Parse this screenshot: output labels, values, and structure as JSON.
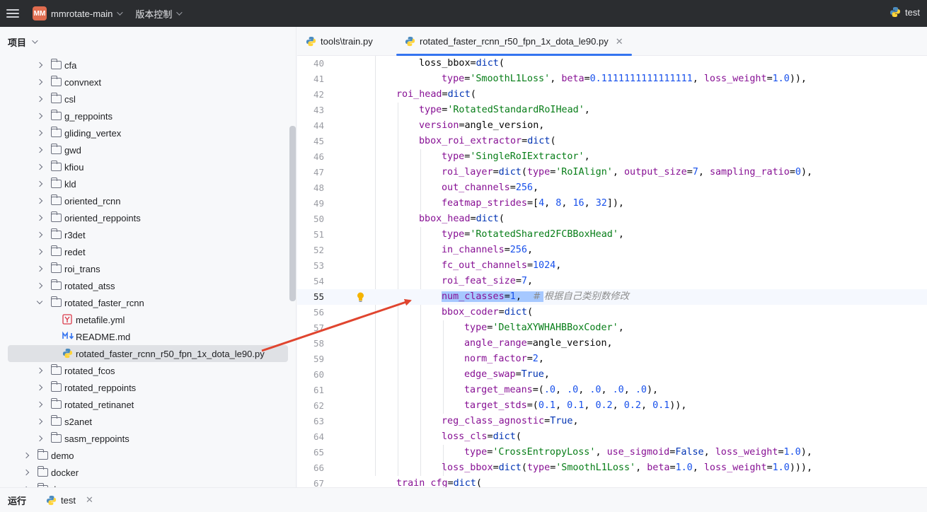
{
  "titlebar": {
    "project_badge": "MM",
    "project_name": "mmrotate-main",
    "vcs_label": "版本控制",
    "run_config": "test"
  },
  "project_panel": {
    "title": "项目",
    "tree": [
      {
        "label": "cfa",
        "type": "folder",
        "depth": 2,
        "expanded": false
      },
      {
        "label": "convnext",
        "type": "folder",
        "depth": 2,
        "expanded": false
      },
      {
        "label": "csl",
        "type": "folder",
        "depth": 2,
        "expanded": false
      },
      {
        "label": "g_reppoints",
        "type": "folder",
        "depth": 2,
        "expanded": false
      },
      {
        "label": "gliding_vertex",
        "type": "folder",
        "depth": 2,
        "expanded": false
      },
      {
        "label": "gwd",
        "type": "folder",
        "depth": 2,
        "expanded": false
      },
      {
        "label": "kfiou",
        "type": "folder",
        "depth": 2,
        "expanded": false
      },
      {
        "label": "kld",
        "type": "folder",
        "depth": 2,
        "expanded": false
      },
      {
        "label": "oriented_rcnn",
        "type": "folder",
        "depth": 2,
        "expanded": false
      },
      {
        "label": "oriented_reppoints",
        "type": "folder",
        "depth": 2,
        "expanded": false
      },
      {
        "label": "r3det",
        "type": "folder",
        "depth": 2,
        "expanded": false
      },
      {
        "label": "redet",
        "type": "folder",
        "depth": 2,
        "expanded": false
      },
      {
        "label": "roi_trans",
        "type": "folder",
        "depth": 2,
        "expanded": false
      },
      {
        "label": "rotated_atss",
        "type": "folder",
        "depth": 2,
        "expanded": false
      },
      {
        "label": "rotated_faster_rcnn",
        "type": "folder",
        "depth": 2,
        "expanded": true
      },
      {
        "label": "metafile.yml",
        "type": "yaml",
        "depth": 3
      },
      {
        "label": "README.md",
        "type": "md",
        "depth": 3
      },
      {
        "label": "rotated_faster_rcnn_r50_fpn_1x_dota_le90.py",
        "type": "py",
        "depth": 3,
        "selected": true
      },
      {
        "label": "rotated_fcos",
        "type": "folder",
        "depth": 2,
        "expanded": false
      },
      {
        "label": "rotated_reppoints",
        "type": "folder",
        "depth": 2,
        "expanded": false
      },
      {
        "label": "rotated_retinanet",
        "type": "folder",
        "depth": 2,
        "expanded": false
      },
      {
        "label": "s2anet",
        "type": "folder",
        "depth": 2,
        "expanded": false
      },
      {
        "label": "sasm_reppoints",
        "type": "folder",
        "depth": 2,
        "expanded": false
      },
      {
        "label": "demo",
        "type": "folder",
        "depth": 1,
        "expanded": false
      },
      {
        "label": "docker",
        "type": "folder",
        "depth": 1,
        "expanded": false
      },
      {
        "label": "d",
        "type": "folder",
        "depth": 1,
        "expanded": false
      }
    ]
  },
  "tabs": [
    {
      "label": "tools\\train.py",
      "active": false
    },
    {
      "label": "rotated_faster_rcnn_r50_fpn_1x_dota_le90.py",
      "active": true
    }
  ],
  "editor": {
    "current_line": 55,
    "lines": [
      {
        "n": 40,
        "indent": 2,
        "tokens": [
          [
            "p",
            "loss_bbox="
          ],
          [
            "bi",
            "dict"
          ],
          [
            "p",
            "("
          ]
        ]
      },
      {
        "n": 41,
        "indent": 3,
        "tokens": [
          [
            "kw",
            "type"
          ],
          [
            "p",
            "="
          ],
          [
            "str",
            "'SmoothL1Loss'"
          ],
          [
            "p",
            ", "
          ],
          [
            "kw",
            "beta"
          ],
          [
            "p",
            "="
          ],
          [
            "num",
            "0.1111111111111111"
          ],
          [
            "p",
            ", "
          ],
          [
            "kw",
            "loss_weight"
          ],
          [
            "p",
            "="
          ],
          [
            "num",
            "1.0"
          ],
          [
            "p",
            ")),"
          ]
        ]
      },
      {
        "n": 42,
        "indent": 1,
        "tokens": [
          [
            "kw",
            "roi_head"
          ],
          [
            "p",
            "="
          ],
          [
            "bi",
            "dict"
          ],
          [
            "p",
            "("
          ]
        ]
      },
      {
        "n": 43,
        "indent": 2,
        "tokens": [
          [
            "kw",
            "type"
          ],
          [
            "p",
            "="
          ],
          [
            "str",
            "'RotatedStandardRoIHead'"
          ],
          [
            "p",
            ","
          ]
        ]
      },
      {
        "n": 44,
        "indent": 2,
        "tokens": [
          [
            "kw",
            "version"
          ],
          [
            "p",
            "=angle_version,"
          ]
        ]
      },
      {
        "n": 45,
        "indent": 2,
        "tokens": [
          [
            "kw",
            "bbox_roi_extractor"
          ],
          [
            "p",
            "="
          ],
          [
            "bi",
            "dict"
          ],
          [
            "p",
            "("
          ]
        ]
      },
      {
        "n": 46,
        "indent": 3,
        "tokens": [
          [
            "kw",
            "type"
          ],
          [
            "p",
            "="
          ],
          [
            "str",
            "'SingleRoIExtractor'"
          ],
          [
            "p",
            ","
          ]
        ]
      },
      {
        "n": 47,
        "indent": 3,
        "tokens": [
          [
            "kw",
            "roi_layer"
          ],
          [
            "p",
            "="
          ],
          [
            "bi",
            "dict"
          ],
          [
            "p",
            "("
          ],
          [
            "kw",
            "type"
          ],
          [
            "p",
            "="
          ],
          [
            "str",
            "'RoIAlign'"
          ],
          [
            "p",
            ", "
          ],
          [
            "kw",
            "output_size"
          ],
          [
            "p",
            "="
          ],
          [
            "num",
            "7"
          ],
          [
            "p",
            ", "
          ],
          [
            "kw",
            "sampling_ratio"
          ],
          [
            "p",
            "="
          ],
          [
            "num",
            "0"
          ],
          [
            "p",
            "),"
          ]
        ]
      },
      {
        "n": 48,
        "indent": 3,
        "tokens": [
          [
            "kw",
            "out_channels"
          ],
          [
            "p",
            "="
          ],
          [
            "num",
            "256"
          ],
          [
            "p",
            ","
          ]
        ]
      },
      {
        "n": 49,
        "indent": 3,
        "tokens": [
          [
            "kw",
            "featmap_strides"
          ],
          [
            "p",
            "=["
          ],
          [
            "num",
            "4"
          ],
          [
            "p",
            ", "
          ],
          [
            "num",
            "8"
          ],
          [
            "p",
            ", "
          ],
          [
            "num",
            "16"
          ],
          [
            "p",
            ", "
          ],
          [
            "num",
            "32"
          ],
          [
            "p",
            "]),"
          ]
        ]
      },
      {
        "n": 50,
        "indent": 2,
        "tokens": [
          [
            "kw",
            "bbox_head"
          ],
          [
            "p",
            "="
          ],
          [
            "bi",
            "dict"
          ],
          [
            "p",
            "("
          ]
        ]
      },
      {
        "n": 51,
        "indent": 3,
        "tokens": [
          [
            "kw",
            "type"
          ],
          [
            "p",
            "="
          ],
          [
            "str",
            "'RotatedShared2FCBBoxHead'"
          ],
          [
            "p",
            ","
          ]
        ]
      },
      {
        "n": 52,
        "indent": 3,
        "tokens": [
          [
            "kw",
            "in_channels"
          ],
          [
            "p",
            "="
          ],
          [
            "num",
            "256"
          ],
          [
            "p",
            ","
          ]
        ]
      },
      {
        "n": 53,
        "indent": 3,
        "tokens": [
          [
            "kw",
            "fc_out_channels"
          ],
          [
            "p",
            "="
          ],
          [
            "num",
            "1024"
          ],
          [
            "p",
            ","
          ]
        ]
      },
      {
        "n": 54,
        "indent": 3,
        "tokens": [
          [
            "kw",
            "roi_feat_size"
          ],
          [
            "p",
            "="
          ],
          [
            "num",
            "7"
          ],
          [
            "p",
            ","
          ]
        ]
      },
      {
        "n": 55,
        "indent": 3,
        "tokens": [
          [
            "kwh",
            "num_classes"
          ],
          [
            "ph",
            "="
          ],
          [
            "numh",
            "1"
          ],
          [
            "ph",
            ",  "
          ],
          [
            "cmth",
            "# "
          ],
          [
            "cmt",
            "根据自己类别数修改"
          ]
        ]
      },
      {
        "n": 56,
        "indent": 3,
        "tokens": [
          [
            "kw",
            "bbox_coder"
          ],
          [
            "p",
            "="
          ],
          [
            "bi",
            "dict"
          ],
          [
            "p",
            "("
          ]
        ]
      },
      {
        "n": 57,
        "indent": 4,
        "tokens": [
          [
            "kw",
            "type"
          ],
          [
            "p",
            "="
          ],
          [
            "str",
            "'DeltaXYWHAHBBoxCoder'"
          ],
          [
            "p",
            ","
          ]
        ]
      },
      {
        "n": 58,
        "indent": 4,
        "tokens": [
          [
            "kw",
            "angle_range"
          ],
          [
            "p",
            "=angle_version,"
          ]
        ]
      },
      {
        "n": 59,
        "indent": 4,
        "tokens": [
          [
            "kw",
            "norm_factor"
          ],
          [
            "p",
            "="
          ],
          [
            "num",
            "2"
          ],
          [
            "p",
            ","
          ]
        ]
      },
      {
        "n": 60,
        "indent": 4,
        "tokens": [
          [
            "kw",
            "edge_swap"
          ],
          [
            "p",
            "="
          ],
          [
            "bi",
            "True"
          ],
          [
            "p",
            ","
          ]
        ]
      },
      {
        "n": 61,
        "indent": 4,
        "tokens": [
          [
            "kw",
            "target_means"
          ],
          [
            "p",
            "=("
          ],
          [
            "num",
            ".0"
          ],
          [
            "p",
            ", "
          ],
          [
            "num",
            ".0"
          ],
          [
            "p",
            ", "
          ],
          [
            "num",
            ".0"
          ],
          [
            "p",
            ", "
          ],
          [
            "num",
            ".0"
          ],
          [
            "p",
            ", "
          ],
          [
            "num",
            ".0"
          ],
          [
            "p",
            "),"
          ]
        ]
      },
      {
        "n": 62,
        "indent": 4,
        "tokens": [
          [
            "kw",
            "target_stds"
          ],
          [
            "p",
            "=("
          ],
          [
            "num",
            "0.1"
          ],
          [
            "p",
            ", "
          ],
          [
            "num",
            "0.1"
          ],
          [
            "p",
            ", "
          ],
          [
            "num",
            "0.2"
          ],
          [
            "p",
            ", "
          ],
          [
            "num",
            "0.2"
          ],
          [
            "p",
            ", "
          ],
          [
            "num",
            "0.1"
          ],
          [
            "p",
            ")),"
          ]
        ]
      },
      {
        "n": 63,
        "indent": 3,
        "tokens": [
          [
            "kw",
            "reg_class_agnostic"
          ],
          [
            "p",
            "="
          ],
          [
            "bi",
            "True"
          ],
          [
            "p",
            ","
          ]
        ]
      },
      {
        "n": 64,
        "indent": 3,
        "tokens": [
          [
            "kw",
            "loss_cls"
          ],
          [
            "p",
            "="
          ],
          [
            "bi",
            "dict"
          ],
          [
            "p",
            "("
          ]
        ]
      },
      {
        "n": 65,
        "indent": 4,
        "tokens": [
          [
            "kw",
            "type"
          ],
          [
            "p",
            "="
          ],
          [
            "str",
            "'CrossEntropyLoss'"
          ],
          [
            "p",
            ", "
          ],
          [
            "kw",
            "use_sigmoid"
          ],
          [
            "p",
            "="
          ],
          [
            "bi",
            "False"
          ],
          [
            "p",
            ", "
          ],
          [
            "kw",
            "loss_weight"
          ],
          [
            "p",
            "="
          ],
          [
            "num",
            "1.0"
          ],
          [
            "p",
            "),"
          ]
        ]
      },
      {
        "n": 66,
        "indent": 3,
        "tokens": [
          [
            "kw",
            "loss_bbox"
          ],
          [
            "p",
            "="
          ],
          [
            "bi",
            "dict"
          ],
          [
            "p",
            "("
          ],
          [
            "kw",
            "type"
          ],
          [
            "p",
            "="
          ],
          [
            "str",
            "'SmoothL1Loss'"
          ],
          [
            "p",
            ", "
          ],
          [
            "kw",
            "beta"
          ],
          [
            "p",
            "="
          ],
          [
            "num",
            "1.0"
          ],
          [
            "p",
            ", "
          ],
          [
            "kw",
            "loss_weight"
          ],
          [
            "p",
            "="
          ],
          [
            "num",
            "1.0"
          ],
          [
            "p",
            "))),"
          ]
        ]
      },
      {
        "n": 67,
        "indent": 1,
        "tokens": [
          [
            "kw",
            "train_cfg"
          ],
          [
            "p",
            "="
          ],
          [
            "bi",
            "dict"
          ],
          [
            "p",
            "("
          ]
        ]
      }
    ]
  },
  "bottombar": {
    "run_label": "运行",
    "run_tab": "test"
  },
  "colors": {
    "accent": "#3574f0",
    "annotation_arrow": "#e0452f",
    "selection": "#a6c8ff"
  }
}
